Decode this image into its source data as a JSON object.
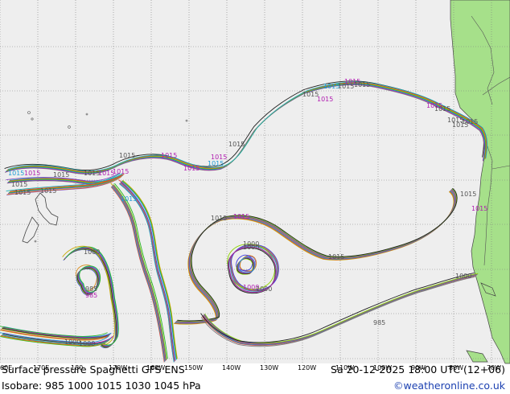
{
  "map": {
    "colors": {
      "ocean": "#eeeeee",
      "land": "#a6e08a",
      "grid": "#7f7f7f",
      "coast": "#444444",
      "isobar_palette": [
        "#1e1e1e",
        "#7a7a7a",
        "#b01bb0",
        "#1e9bd6",
        "#27b327",
        "#c8a800",
        "#e23b3b",
        "#15b3b3",
        "#7f3fbf",
        "#d98b1a",
        "#3b3be2",
        "#8fd400"
      ]
    },
    "lon_labels": [
      "60E",
      "170E",
      "180",
      "170W",
      "160W",
      "150W",
      "140W",
      "130W",
      "120W",
      "110W",
      "100W",
      "90W",
      "80W",
      "70W"
    ],
    "isobar_labels": [
      {
        "text": "1015",
        "color": "#555555"
      },
      {
        "text": "1015",
        "color": "#b01bb0"
      },
      {
        "text": "1015",
        "color": "#b01bb0"
      },
      {
        "text": "1015",
        "color": "#1e9bd6"
      },
      {
        "text": "1015",
        "color": "#b01bb0"
      },
      {
        "text": "1015",
        "color": "#555555"
      },
      {
        "text": "1015",
        "color": "#555555"
      },
      {
        "text": "1015",
        "color": "#555555"
      },
      {
        "text": "1015",
        "color": "#b01bb0"
      },
      {
        "text": "1015",
        "color": "#1e9bd6"
      },
      {
        "text": "1015",
        "color": "#b01bb0"
      },
      {
        "text": "1015",
        "color": "#555555"
      },
      {
        "text": "1015",
        "color": "#555555"
      },
      {
        "text": "1015",
        "color": "#555555"
      },
      {
        "text": "1015",
        "color": "#b01bb0"
      },
      {
        "text": "1015",
        "color": "#1e9bd6"
      },
      {
        "text": "1015",
        "color": "#555555"
      },
      {
        "text": "1015",
        "color": "#b01bb0"
      },
      {
        "text": "1015",
        "color": "#555555"
      },
      {
        "text": "1015",
        "color": "#b01bb0"
      },
      {
        "text": "1015",
        "color": "#1e9bd6"
      },
      {
        "text": "1015",
        "color": "#b01bb0"
      },
      {
        "text": "1015",
        "color": "#555555"
      },
      {
        "text": "1015",
        "color": "#555555"
      },
      {
        "text": "1015",
        "color": "#b01bb0"
      },
      {
        "text": "1015",
        "color": "#555555"
      },
      {
        "text": "1015",
        "color": "#555555"
      },
      {
        "text": "1015",
        "color": "#555555"
      },
      {
        "text": "1015",
        "color": "#555555"
      },
      {
        "text": "1015",
        "color": "#555555"
      },
      {
        "text": "1015",
        "color": "#b01bb0"
      },
      {
        "text": "1015",
        "color": "#555555"
      },
      {
        "text": "1000",
        "color": "#555555"
      },
      {
        "text": "1000",
        "color": "#555555"
      },
      {
        "text": "1000",
        "color": "#555555"
      },
      {
        "text": "1000",
        "color": "#b01bb0"
      },
      {
        "text": "1000",
        "color": "#555555"
      },
      {
        "text": "1000",
        "color": "#555555"
      },
      {
        "text": "1000",
        "color": "#555555"
      },
      {
        "text": "1000",
        "color": "#555555"
      },
      {
        "text": "985",
        "color": "#555555"
      },
      {
        "text": "985",
        "color": "#b01bb0"
      },
      {
        "text": "985",
        "color": "#555555"
      }
    ]
  },
  "footer": {
    "title": "Surface pressure Spaghetti  GFS ENS",
    "datetime": "Sa 20-12-2025 18:00 UTC (12+06)",
    "isobars": "Isobare: 985  1000  1015  1030  1045  hPa",
    "credit": "©weatheronline.co.uk"
  }
}
